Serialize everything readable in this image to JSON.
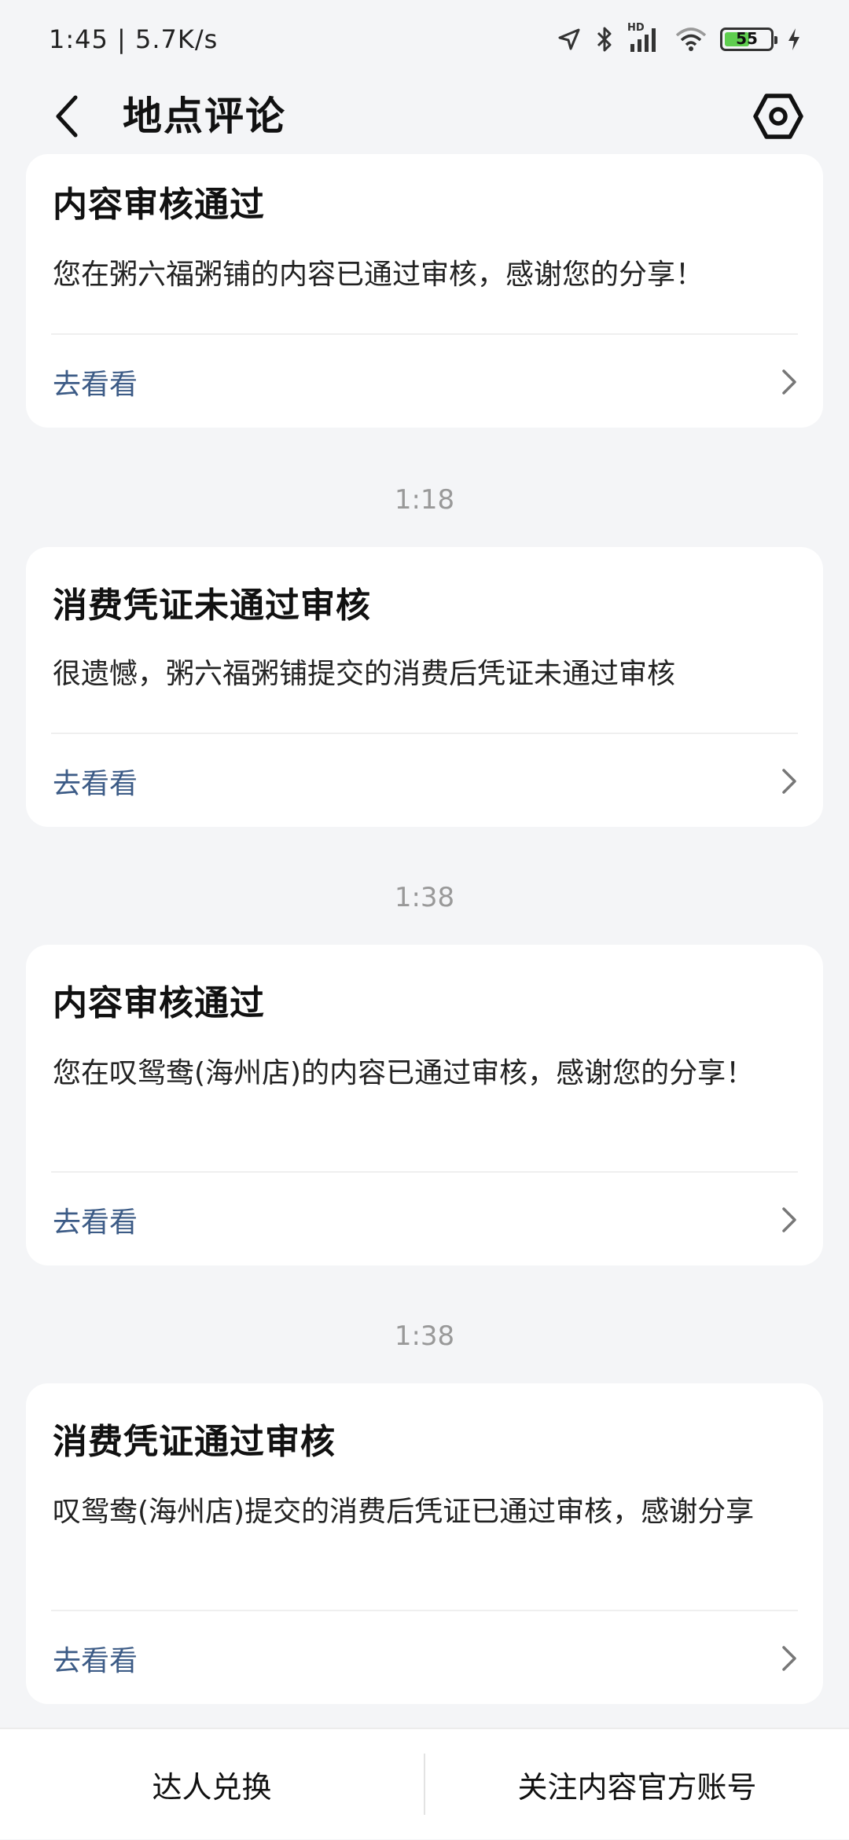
{
  "status_bar": {
    "time_speed": "1:45 | 5.7K/s",
    "battery_level": "55",
    "icons": [
      "location-icon",
      "bluetooth-icon",
      "hd-signal-icon",
      "wifi-icon",
      "battery-icon",
      "charging-icon"
    ],
    "hd_label": "HD"
  },
  "header": {
    "title": "地点评论",
    "back_icon": "back-chevron-icon",
    "settings_icon": "settings-hex-icon"
  },
  "feed": {
    "items": [
      {
        "title": "内容审核通过",
        "body": "您在粥六福粥铺的内容已通过审核，感谢您的分享！",
        "action": "去看看"
      },
      {
        "timestamp": "1:18",
        "title": "消费凭证未通过审核",
        "body": "很遗憾，粥六福粥铺提交的消费后凭证未通过审核",
        "action": "去看看"
      },
      {
        "timestamp": "1:38",
        "title": "内容审核通过",
        "body": "您在叹鸳鸯(海州店)的内容已通过审核，感谢您的分享！",
        "action": "去看看"
      },
      {
        "timestamp": "1:38",
        "title": "消费凭证通过审核",
        "body": "叹鸳鸯(海州店)提交的消费后凭证已通过审核，感谢分享",
        "action": "去看看"
      }
    ]
  },
  "bottom_bar": {
    "left_label": "达人兑换",
    "right_label": "关注内容官方账号"
  },
  "colors": {
    "background": "#f4f5f7",
    "card": "#ffffff",
    "link": "#3c5b86",
    "timestamp": "#999999",
    "battery_fill": "#5fce4f"
  }
}
